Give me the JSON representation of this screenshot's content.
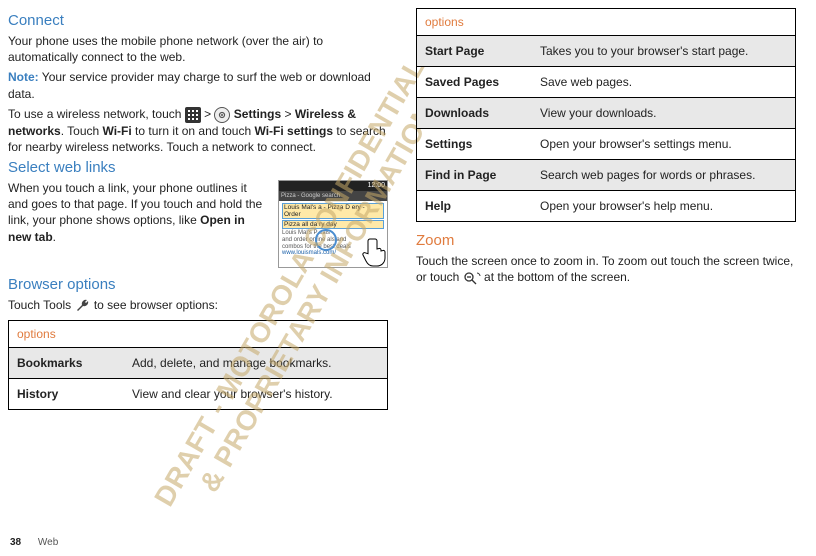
{
  "left": {
    "h_connect": "Connect",
    "connect_p": "Your phone uses the mobile phone network (over the air) to automatically connect to the web.",
    "note_label": "Note:",
    "note_text": " Your service provider may charge to surf the web or download data.",
    "wifi_a": "To use a wireless network, touch ",
    "wifi_gt": " > ",
    "wifi_settings": " Settings",
    "wifi_b": " > ",
    "wifi_wn": "Wireless & networks",
    "wifi_c": ". Touch ",
    "wifi_wifi": "Wi-Fi",
    "wifi_d": " to turn it on and touch ",
    "wifi_ws": "Wi-Fi settings",
    "wifi_e": " to search for nearby wireless networks. Touch a network to connect.",
    "h_links": "Select web links",
    "links_p_a": "When you touch a link, your phone outlines it and goes to that page. If you touch and hold the link, your phone shows options, like ",
    "links_bold": "Open in new tab",
    "links_p_b": ".",
    "h_bopts": "Browser options",
    "bopts_p_a": "Touch Tools ",
    "bopts_p_b": " to see browser options:",
    "table_header": "options",
    "rows": [
      {
        "k": "Bookmarks",
        "v": "Add, delete, and manage bookmarks."
      },
      {
        "k": "History",
        "v": "View and clear your browser's history."
      }
    ],
    "thumb": {
      "time": "12:00",
      "url": "Pizza - Google search",
      "line1": "Louis Mal's    a - Pizza D   ery - Order",
      "line2": "Pizza all da   ry day",
      "tiny1": "Louis Mal's P             eals",
      "tiny2": "and order online        als and",
      "tiny3": "combos for the best deals",
      "link": "www.louismals.com/"
    }
  },
  "right": {
    "table_header": "options",
    "rows": [
      {
        "k": "Start Page",
        "v": "Takes you to your browser's start page."
      },
      {
        "k": "Saved Pages",
        "v": "Save web pages."
      },
      {
        "k": "Downloads",
        "v": "View your downloads."
      },
      {
        "k": "Settings",
        "v": "Open your browser's settings menu."
      },
      {
        "k": "Find in Page",
        "v": "Search web pages for words or phrases."
      },
      {
        "k": "Help",
        "v": "Open your browser's help menu."
      }
    ],
    "h_zoom": "Zoom",
    "zoom_a": "Touch the screen once to zoom in. To zoom out touch the screen twice, or touch ",
    "zoom_b": " at the bottom of the screen."
  },
  "watermark": "DRAFT - MOTOROLA CONFIDENTIAL\n& PROPRIETARY INFORMATION",
  "footer": {
    "page": "38",
    "section": "Web"
  }
}
